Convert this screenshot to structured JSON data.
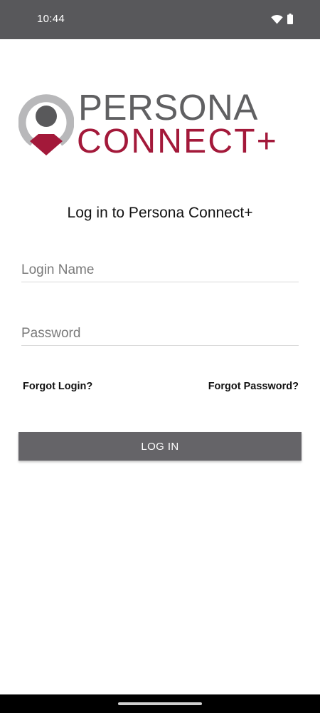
{
  "status_bar": {
    "time": "10:44",
    "icons": [
      "wifi-icon",
      "battery-icon"
    ]
  },
  "logo": {
    "line1": "PERSONA",
    "line2": "CONNECT+",
    "colors": {
      "gray": "#606062",
      "red": "#a3193a",
      "ring": "#b8b8ba"
    }
  },
  "login": {
    "heading": "Log in to Persona Connect+",
    "login_name_placeholder": "Login Name",
    "password_placeholder": "Password",
    "forgot_login": "Forgot Login?",
    "forgot_password": "Forgot Password?",
    "login_button": "LOG IN"
  },
  "colors": {
    "status_bar": "#58585b",
    "button": "#656468",
    "nav_bar": "#000000"
  }
}
